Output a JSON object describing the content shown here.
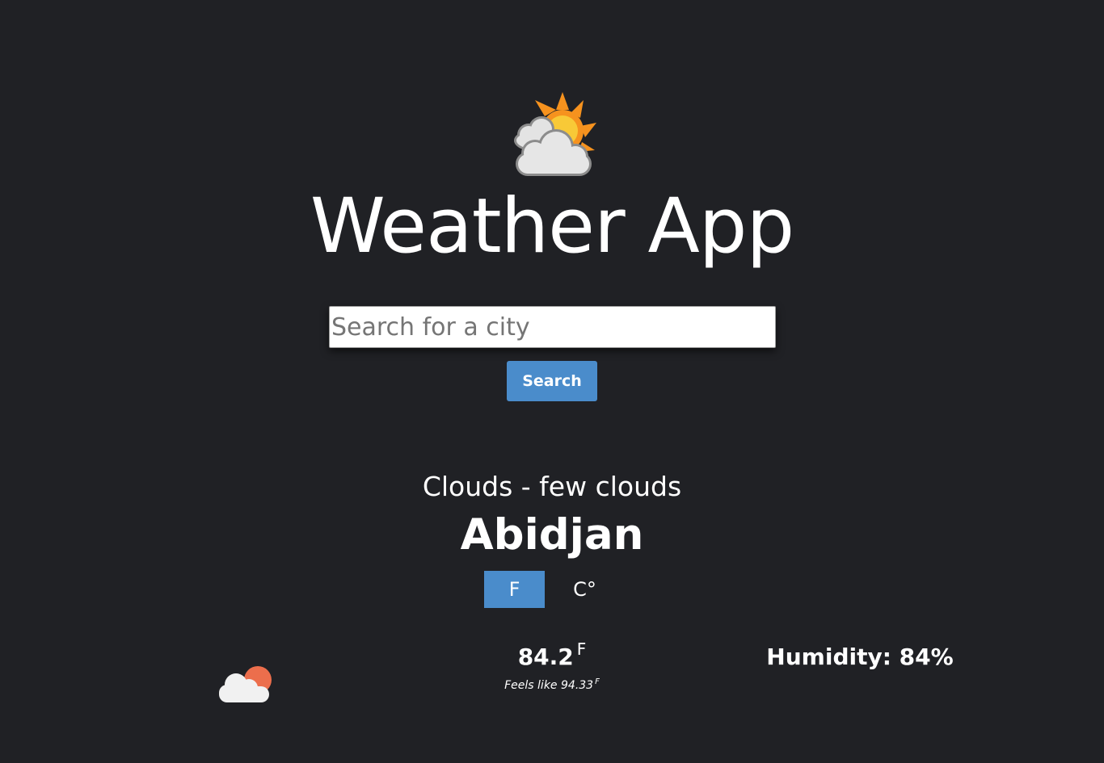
{
  "header": {
    "logo_icon": "sun-behind-clouds-icon",
    "title": "Weather App"
  },
  "search": {
    "placeholder": "Search for a city",
    "value": "",
    "button_label": "Search"
  },
  "weather": {
    "description": "Clouds - few clouds",
    "city": "Abidjan",
    "icon": "cloud-with-sun-icon",
    "temperature": "84.2",
    "temperature_unit": "F",
    "feels_like_label": "Feels like",
    "feels_like": "94.33",
    "feels_like_unit": "F",
    "humidity": "Humidity: 84%"
  },
  "units": {
    "fahrenheit_label": "F",
    "celsius_label": "C°",
    "selected": "F"
  },
  "colors": {
    "background": "#202125",
    "accent": "#4a8ccb",
    "text": "#ffffff"
  }
}
